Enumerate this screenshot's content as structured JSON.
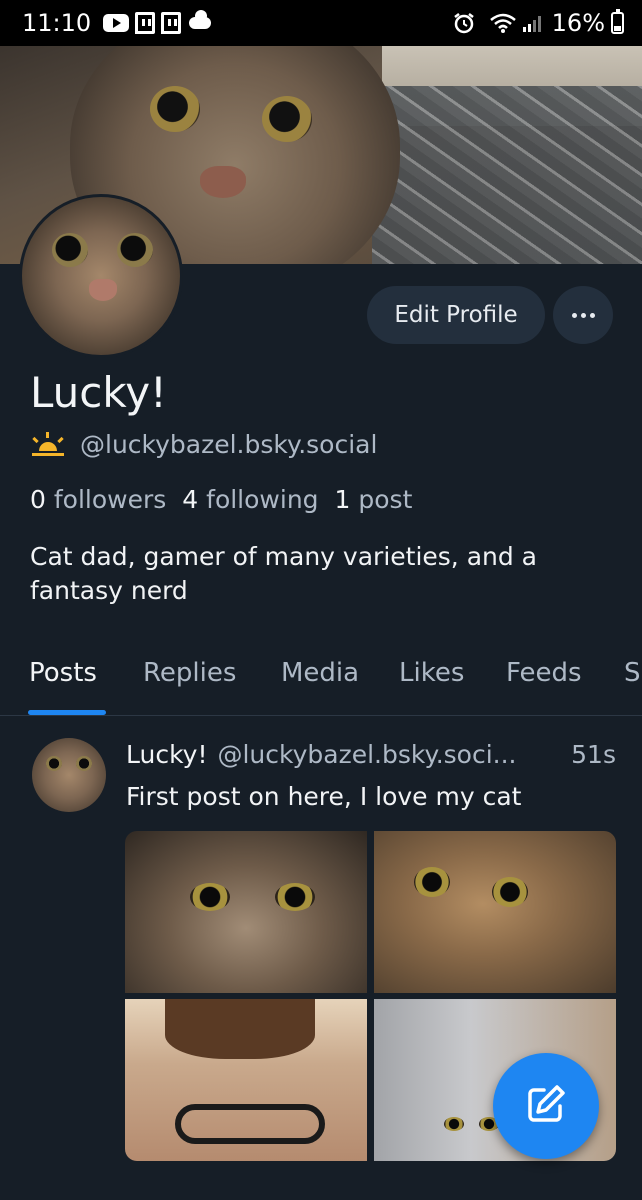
{
  "status_bar": {
    "time": "11:10",
    "battery": "16%",
    "icons": [
      "youtube-icon",
      "twitch-icon",
      "twitch-icon",
      "cloud-icon",
      "alarm-icon",
      "wifi-icon",
      "signal-icon",
      "battery-icon"
    ]
  },
  "profile": {
    "name": "Lucky!",
    "handle": "@luckybazel.bsky.social",
    "handle_icon": "sunrise-icon",
    "stats": {
      "followers_count": "0",
      "followers_label": "followers",
      "following_count": "4",
      "following_label": "following",
      "posts_count": "1",
      "posts_label": "post"
    },
    "bio": "Cat dad, gamer of many varieties, and a fantasy nerd",
    "edit_button": "Edit Profile",
    "more_button_icon": "ellipsis-icon"
  },
  "tabs": [
    {
      "label": "Posts",
      "active": true
    },
    {
      "label": "Replies",
      "active": false
    },
    {
      "label": "Media",
      "active": false
    },
    {
      "label": "Likes",
      "active": false
    },
    {
      "label": "Feeds",
      "active": false
    },
    {
      "label": "S",
      "active": false
    }
  ],
  "post": {
    "author_name": "Lucky!",
    "author_handle": "@luckybazel.bsky.soci...",
    "time": "51s",
    "text": "First post on here, I love my cat",
    "image_count": 4
  },
  "fab_icon": "compose-icon",
  "colors": {
    "background": "#161e27",
    "accent": "#1e86f2",
    "muted_text": "#aeb9c6",
    "button_bg": "#232f3d"
  }
}
